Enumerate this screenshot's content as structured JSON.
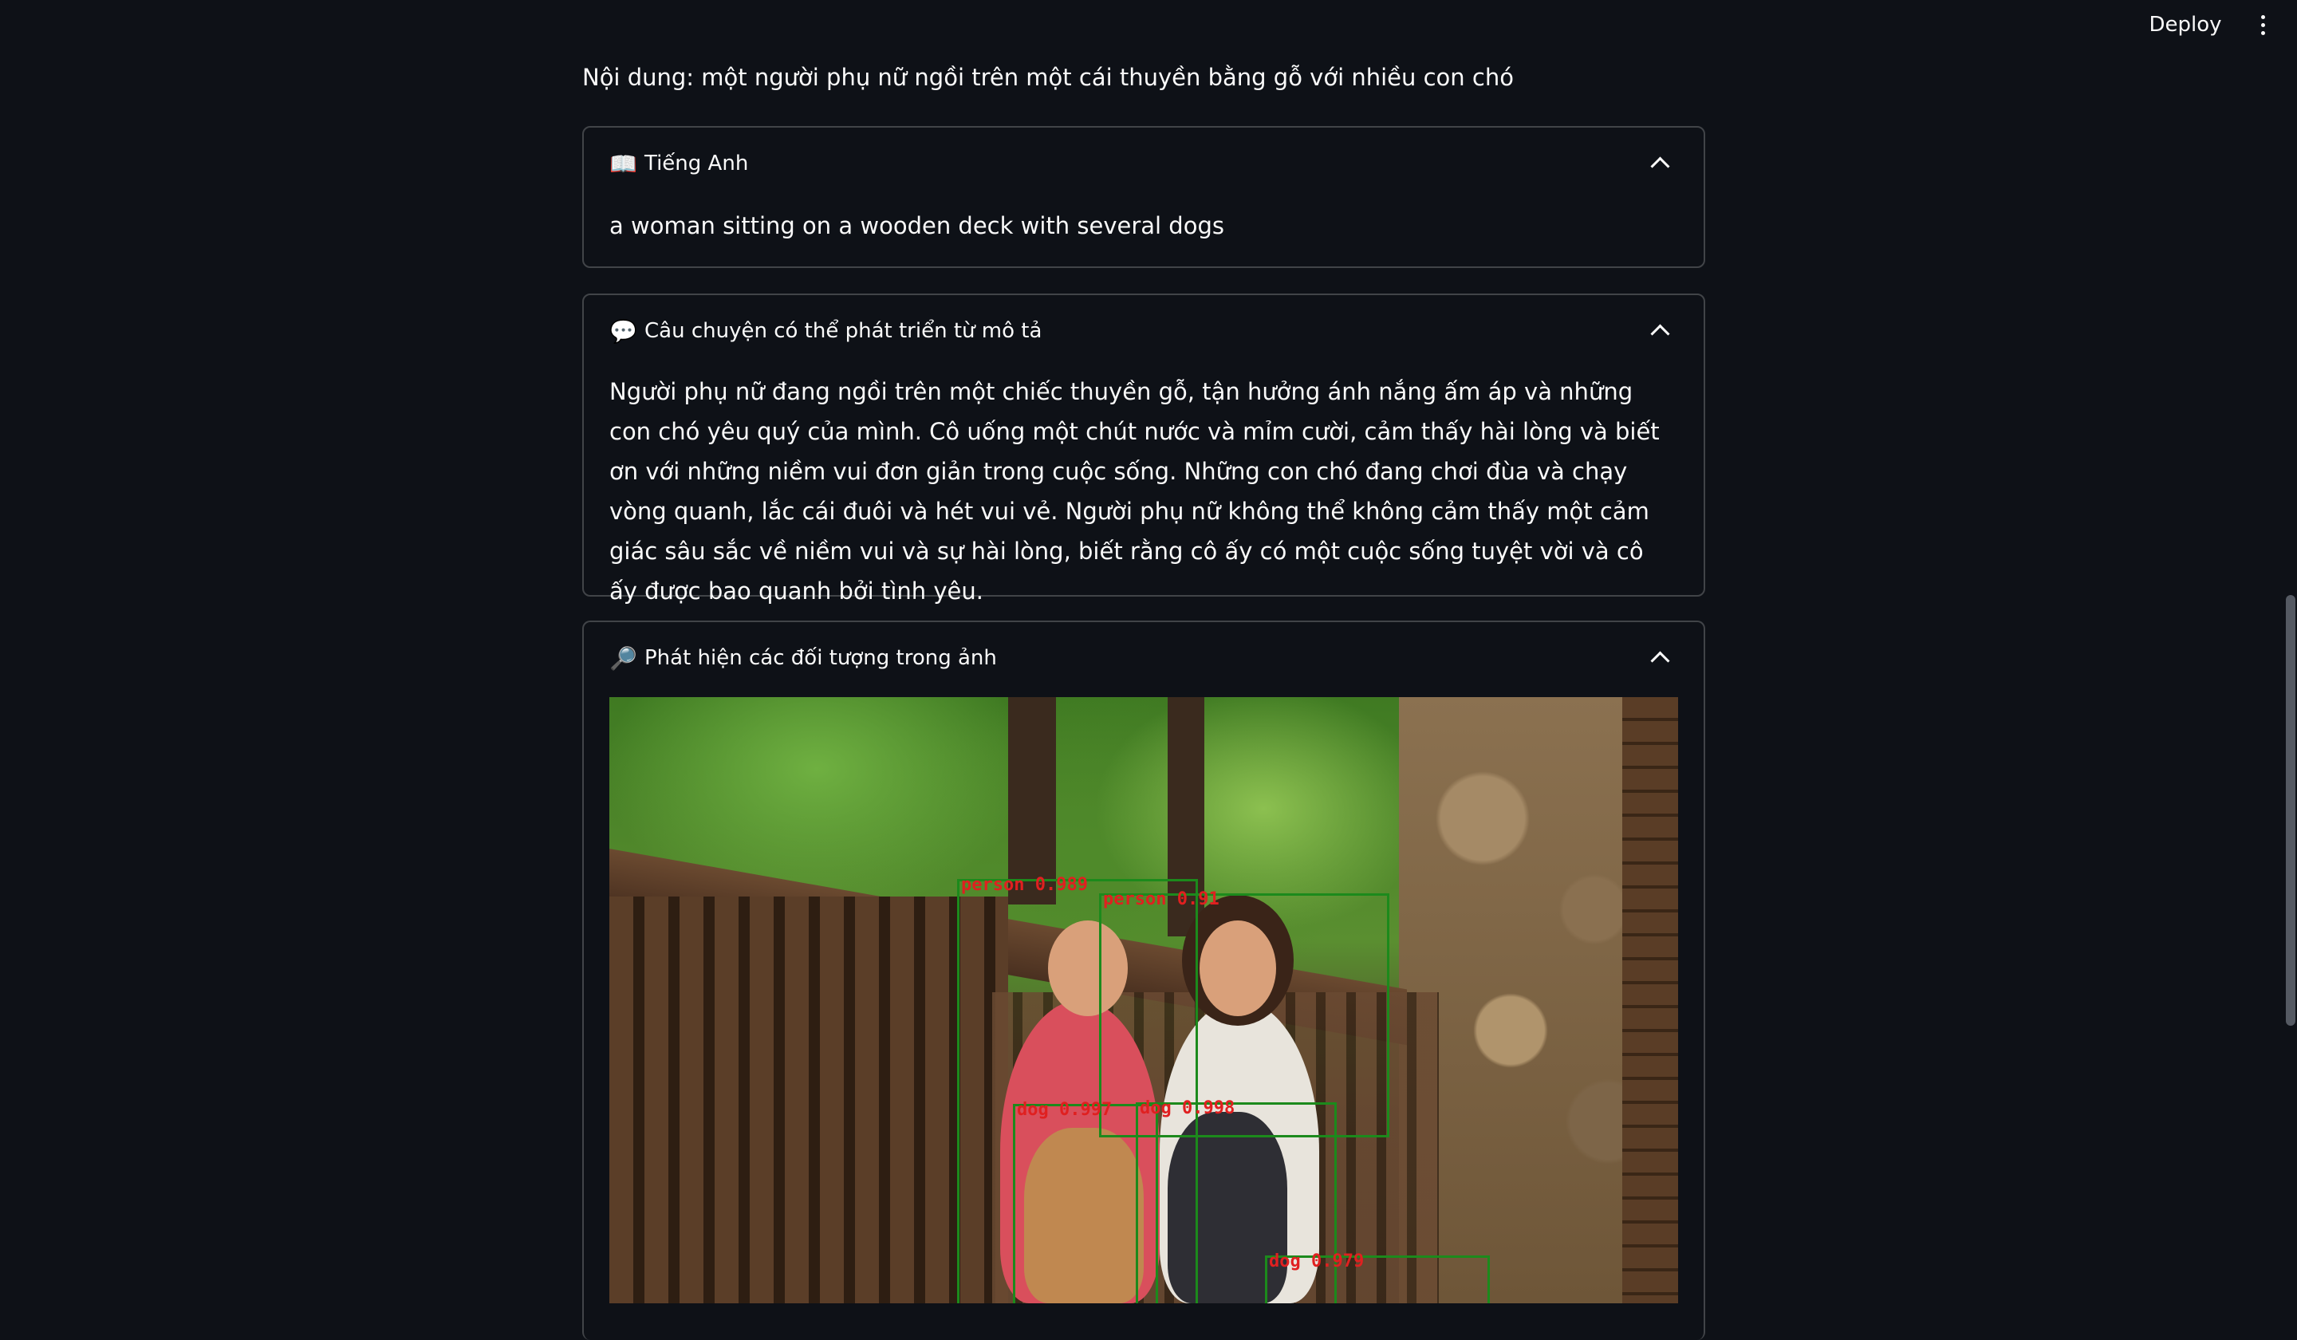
{
  "header": {
    "deploy_label": "Deploy",
    "menu_icon": "more-vertical-icon"
  },
  "content_line": "Nội dung: một người phụ nữ ngồi trên một cái thuyền bằng gỗ với nhiều con chó",
  "expanders": [
    {
      "icon": "📖",
      "icon_name": "open-book-icon",
      "title": "Tiếng Anh",
      "text": "a woman sitting on a wooden deck with several dogs"
    },
    {
      "icon": "💬",
      "icon_name": "speech-bubble-icon",
      "title": "Câu chuyện có thể phát triển từ mô tả",
      "text": "Người phụ nữ đang ngồi trên một chiếc thuyền gỗ, tận hưởng ánh nắng ấm áp và những con chó yêu quý của mình. Cô uống một chút nước và mỉm cười, cảm thấy hài lòng và biết ơn với những niềm vui đơn giản trong cuộc sống. Những con chó đang chơi đùa và chạy vòng quanh, lắc cái đuôi và hét vui vẻ. Người phụ nữ không thể không cảm thấy một cảm giác sâu sắc về niềm vui và sự hài lòng, biết rằng cô ấy có một cuộc sống tuyệt vời và cô ấy được bao quanh bởi tình yêu."
    },
    {
      "icon": "🔎",
      "icon_name": "magnifying-glass-icon",
      "title": "Phát hiện các đối tượng trong ảnh"
    }
  ],
  "detections": [
    {
      "label": "person 0.989"
    },
    {
      "label": "person 0.91"
    },
    {
      "label": "dog 0.997"
    },
    {
      "label": "dog 0.998"
    },
    {
      "label": "dog 0.979"
    }
  ],
  "colors": {
    "background": "#0e1117",
    "text": "#fafafa",
    "box": "#1c8a1c",
    "box_label": "#e02020"
  }
}
